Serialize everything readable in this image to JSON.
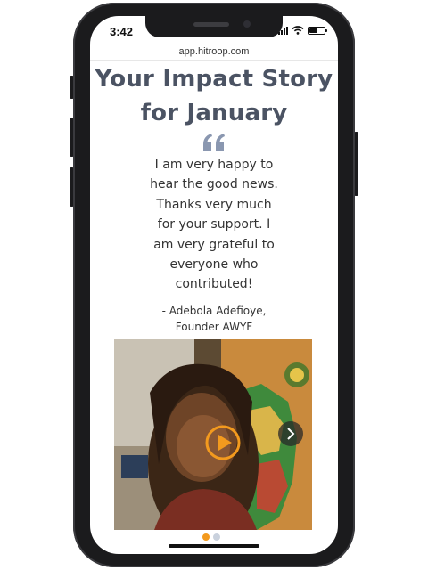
{
  "status_bar": {
    "time": "3:42",
    "signal_icon": "cellular-signal-icon",
    "wifi_icon": "wifi-icon",
    "battery_icon": "battery-icon"
  },
  "browser": {
    "url": "app.hitroop.com"
  },
  "page": {
    "title_line1": "Your Impact Story",
    "title_line2": "for January",
    "quote_icon": "quote-marks-icon",
    "quote_lines": [
      "I am very happy to",
      "hear the good news.",
      "Thanks very much",
      "for your support. I",
      "am very grateful to",
      "everyone who",
      "contributed!"
    ],
    "attribution_line1": "- Adebola Adefioye,",
    "attribution_line2": "Founder AWYF"
  },
  "video": {
    "play_icon": "play-icon",
    "next_icon": "chevron-right-icon"
  },
  "carousel": {
    "slide_count": 2,
    "active_index": 0
  },
  "colors": {
    "title": "#4b5363",
    "accent_orange": "#f39a1e",
    "quote_icon": "#8a97b0",
    "dot_active": "#f39a1e",
    "dot_inactive": "#c9d1dd"
  }
}
